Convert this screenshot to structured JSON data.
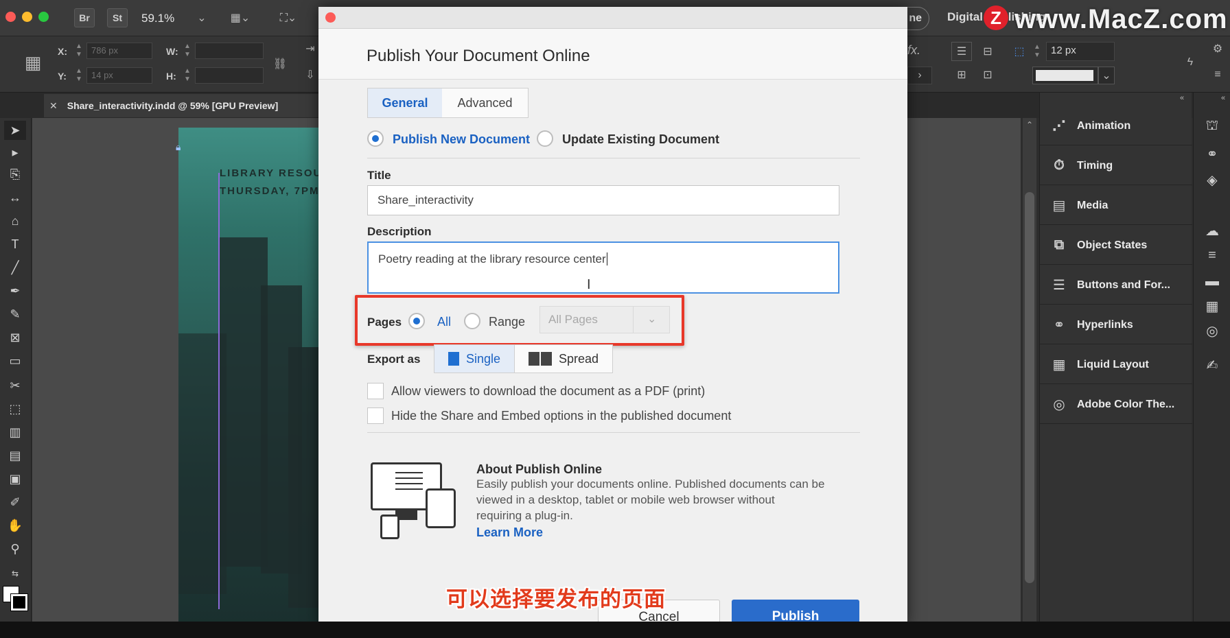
{
  "app": {
    "bridge_label": "Br",
    "stock_label": "St",
    "zoom": "59.1%",
    "workspace": "Digital Publishing",
    "header_pill": "ne"
  },
  "controlbar": {
    "x_label": "X:",
    "x_value": "786 px",
    "y_label": "Y:",
    "y_value": "14 px",
    "w_label": "W:",
    "h_label": "H:",
    "stroke_value": "12 px",
    "fx_label": "fx."
  },
  "document": {
    "tab_label": "Share_interactivity.indd @ 59% [GPU Preview]",
    "line1": "LIBRARY RESOU",
    "line2": "THURSDAY, 7PM"
  },
  "panels": [
    {
      "label": "Animation",
      "icon": "animation-icon",
      "glyph": "⋰"
    },
    {
      "label": "Timing",
      "icon": "timing-icon",
      "glyph": "⏱"
    },
    {
      "label": "Media",
      "icon": "media-icon",
      "glyph": "▤"
    },
    {
      "label": "Object States",
      "icon": "object-states-icon",
      "glyph": "⧉"
    },
    {
      "label": "Buttons and For...",
      "icon": "buttons-forms-icon",
      "glyph": "☰"
    },
    {
      "label": "Hyperlinks",
      "icon": "hyperlinks-icon",
      "glyph": "⚭"
    },
    {
      "label": "Liquid Layout",
      "icon": "liquid-layout-icon",
      "glyph": "▦"
    },
    {
      "label": "Adobe Color The...",
      "icon": "adobe-color-icon",
      "glyph": "◎"
    }
  ],
  "dialog": {
    "title": "Publish Your Document Online",
    "tabs": {
      "general": "General",
      "advanced": "Advanced"
    },
    "publish_new": "Publish New Document",
    "update_existing": "Update Existing Document",
    "title_label": "Title",
    "title_value": "Share_interactivity",
    "description_label": "Description",
    "description_value": "Poetry reading at the library resource center",
    "pages_label": "Pages",
    "pages_all": "All",
    "pages_range": "Range",
    "pages_select": "All Pages",
    "export_label": "Export as",
    "export_single": "Single",
    "export_spread": "Spread",
    "allow_pdf": "Allow viewers to download the document as a PDF (print)",
    "hide_share": "Hide the Share and Embed options in the published document",
    "about_title": "About Publish Online",
    "about_line1": "Easily publish your documents online. Published documents can be",
    "about_line2": "viewed in a desktop, tablet or mobile web browser without",
    "about_line3": "requiring a plug-in.",
    "learn_more": "Learn More",
    "cancel": "Cancel",
    "publish": "Publish"
  },
  "overlay": {
    "subtitle_cn": "可以选择要发布的页面",
    "watermark": "www.MacZ.com",
    "watermark_logo": "Z"
  },
  "colors": {
    "accent_blue": "#1f6fd1",
    "highlight_red": "#e8382a",
    "publish_button": "#2a6ccb"
  }
}
